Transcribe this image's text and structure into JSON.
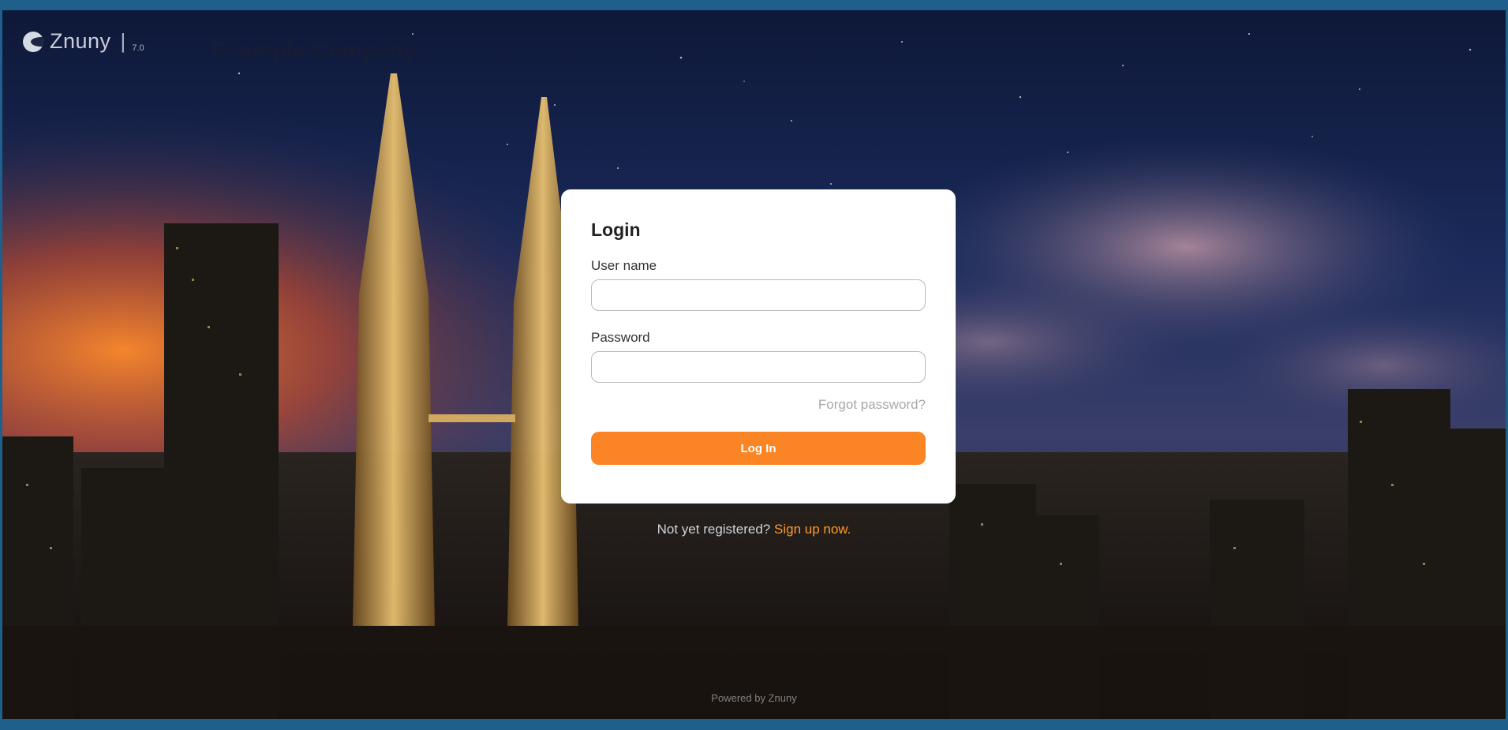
{
  "brand": {
    "logo_text": "Znuny",
    "separator": "|",
    "version": "7.0",
    "company_name": "Example Company"
  },
  "login": {
    "title": "Login",
    "username_label": "User name",
    "username_value": "",
    "password_label": "Password",
    "password_value": "",
    "forgot_password": "Forgot password?",
    "login_button": "Log In"
  },
  "signup": {
    "prompt": "Not yet registered?",
    "link": "Sign up now."
  },
  "footer": {
    "powered_by": "Powered by Znuny"
  },
  "colors": {
    "accent": "#fb8424",
    "frame": "#1f5f8b",
    "card": "#ffffff"
  }
}
